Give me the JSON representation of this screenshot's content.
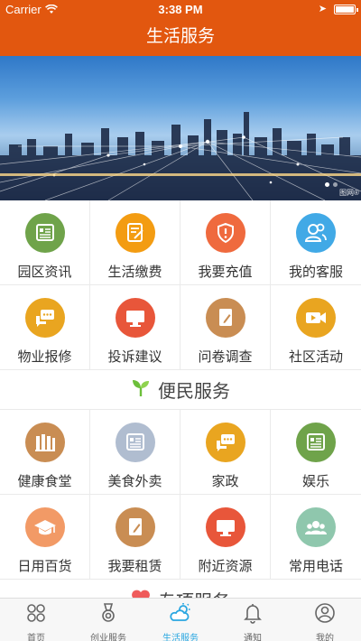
{
  "status_bar": {
    "carrier": "Carrier",
    "time": "3:38 PM"
  },
  "header": {
    "title": "生活服务"
  },
  "banner": {
    "watermark": "图网®",
    "slide_count": 2,
    "active_slide": 1
  },
  "grid_top": [
    {
      "label": "园区资讯",
      "color": "#6fa34a",
      "icon": "news-icon"
    },
    {
      "label": "生活缴费",
      "color": "#f39c12",
      "icon": "bill-icon"
    },
    {
      "label": "我要充值",
      "color": "#ef6a3e",
      "icon": "shield-alert-icon"
    },
    {
      "label": "我的客服",
      "color": "#41a9e6",
      "icon": "customer-service-icon"
    },
    {
      "label": "物业报修",
      "color": "#e9a520",
      "icon": "chat-icon"
    },
    {
      "label": "投诉建议",
      "color": "#e8563a",
      "icon": "monitor-icon"
    },
    {
      "label": "问卷调查",
      "color": "#c98d53",
      "icon": "survey-icon"
    },
    {
      "label": "社区活动",
      "color": "#e9a520",
      "icon": "video-icon"
    }
  ],
  "section_convenience": {
    "title": "便民服务",
    "icon": "sprout-icon",
    "icon_color": "#6cbf3a"
  },
  "grid_convenience": [
    {
      "label": "健康食堂",
      "color": "#c98d53",
      "icon": "books-icon"
    },
    {
      "label": "美食外卖",
      "color": "#b0bdd0",
      "icon": "news-icon"
    },
    {
      "label": "家政",
      "color": "#e9a520",
      "icon": "chat-icon"
    },
    {
      "label": "娱乐",
      "color": "#6fa34a",
      "icon": "news-icon"
    },
    {
      "label": "日用百货",
      "color": "#f29a66",
      "icon": "graduation-cap-icon"
    },
    {
      "label": "我要租赁",
      "color": "#c98d53",
      "icon": "survey-icon"
    },
    {
      "label": "附近资源",
      "color": "#e8563a",
      "icon": "monitor-icon"
    },
    {
      "label": "常用电话",
      "color": "#8fc7ad",
      "icon": "group-icon"
    }
  ],
  "section_special": {
    "title": "专项服务",
    "icon": "heart-icon",
    "icon_color": "#ef5b5b"
  },
  "tabs": [
    {
      "label": "首页",
      "icon": "home-grid-icon",
      "active": false
    },
    {
      "label": "创业服务",
      "icon": "medal-icon",
      "active": false
    },
    {
      "label": "生活服务",
      "icon": "cloud-sun-icon",
      "active": true
    },
    {
      "label": "通知",
      "icon": "bell-icon",
      "active": false
    },
    {
      "label": "我的",
      "icon": "profile-icon",
      "active": false
    }
  ]
}
